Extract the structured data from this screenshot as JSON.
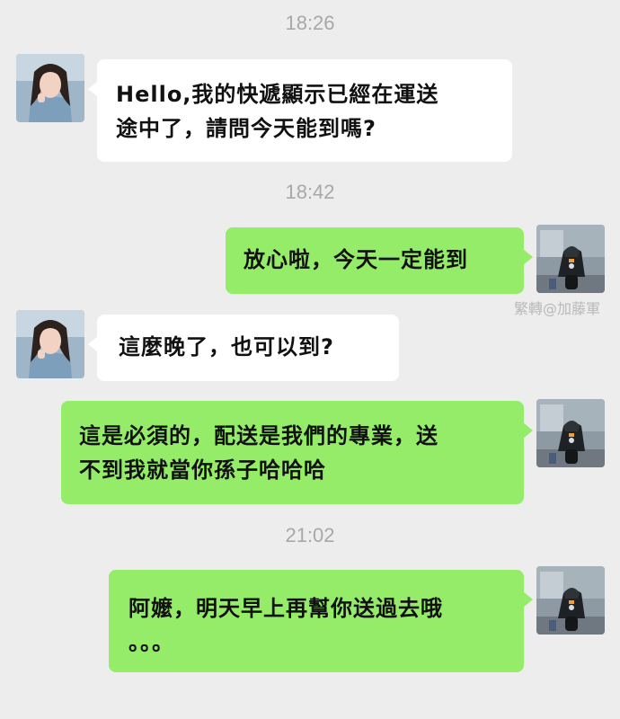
{
  "chat": {
    "messages": [
      {
        "type": "time",
        "text": "18:26"
      },
      {
        "type": "message",
        "side": "left",
        "sender_avatar": "girl-avatar",
        "text": "Hello,我的快遞顯示已經在運送\n途中了，請問今天能到嗎?"
      },
      {
        "type": "time",
        "text": "18:42"
      },
      {
        "type": "message",
        "side": "right",
        "sender_avatar": "scooter-avatar",
        "text": "放心啦，今天一定能到"
      },
      {
        "type": "message",
        "side": "left",
        "sender_avatar": "girl-avatar",
        "text": "這麼晚了，也可以到?"
      },
      {
        "type": "message",
        "side": "right",
        "sender_avatar": "scooter-avatar",
        "text": "這是必須的，配送是我們的專業，送\n不到我就當你孫子哈哈哈"
      },
      {
        "type": "time",
        "text": "21:02"
      },
      {
        "type": "message",
        "side": "right",
        "sender_avatar": "scooter-avatar",
        "text": "阿嬤，明天早上再幫你送過去哦\n。。。"
      }
    ],
    "watermark": "繁轉@加藤軍"
  },
  "colors": {
    "background": "#ededed",
    "bubble_left": "#ffffff",
    "bubble_right": "#95ec69",
    "timestamp_text": "#a8a8a8"
  }
}
